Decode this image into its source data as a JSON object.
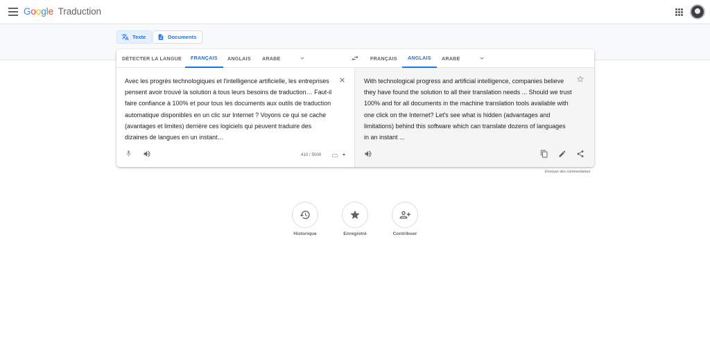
{
  "header": {
    "logo_brand": [
      "G",
      "o",
      "o",
      "g",
      "l",
      "e"
    ],
    "logo_product": "Traduction"
  },
  "modes": {
    "text_label": "Texte",
    "documents_label": "Documents"
  },
  "source_langs": {
    "detect": "DÉTECTER LA LANGUE",
    "items": [
      "FRANÇAIS",
      "ANGLAIS",
      "ARABE"
    ],
    "active": "FRANÇAIS"
  },
  "target_langs": {
    "items": [
      "FRANÇAIS",
      "ANGLAIS",
      "ARABE"
    ],
    "active": "ANGLAIS"
  },
  "source": {
    "text": "Avec les progrès technologiques et l'intelligence artificielle, les entreprises pensent avoir trouvé la solution à tous leurs besoins de traduction… Faut-il faire confiance à 100% et pour tous les documents aux outils de traduction automatique disponibles en un clic sur Internet ? Voyons ce qui se cache (avantages et limites) derrière ces logiciels qui peuvent traduire des dizaines de langues en un instant…",
    "char_count": "410 / 5000"
  },
  "target": {
    "text": "With technological progress and artificial intelligence, companies believe they have found the solution to all their translation needs ... Should we trust 100% and for all documents in the machine translation tools available with one click on the Internet? Let's see what is hidden (advantages and limitations) behind this software which can translate dozens of languages in an instant ..."
  },
  "feedback_label": "Envoyer des commentaires",
  "bottom": [
    {
      "label": "Historique",
      "icon": "history-icon"
    },
    {
      "label": "Enregistré",
      "icon": "star-filled-icon"
    },
    {
      "label": "Contribuer",
      "icon": "contribute-icon"
    }
  ],
  "colors": {
    "accent": "#1a73e8",
    "text": "#202124",
    "muted": "#5f6368"
  }
}
